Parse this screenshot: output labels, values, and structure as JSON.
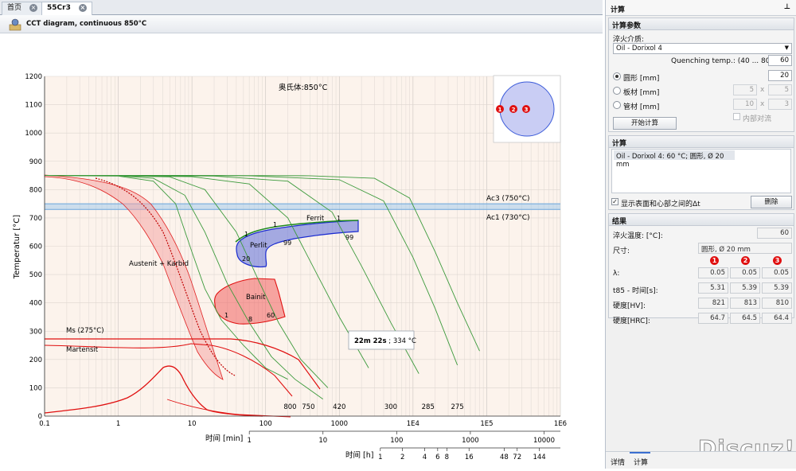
{
  "tabs": [
    {
      "label": "首页",
      "close": "×"
    },
    {
      "label": "55Cr3",
      "close": "×"
    }
  ],
  "doc_title": "CCT diagram, continuous 850°C",
  "colors": {
    "accent_blue": "#3b5bd9",
    "martensite_red": "#e01010",
    "ferrit_green": "#1f8a1f",
    "green_curve": "#3c9a3c",
    "ac_band": "#9cc8ec",
    "plot_bg": "#fcf3ec"
  },
  "chart_data": {
    "type": "line",
    "ylabel": "Temperatur [°C]",
    "ylim": [
      0,
      1200
    ],
    "yticks": [
      0,
      100,
      200,
      300,
      400,
      500,
      600,
      700,
      800,
      900,
      1000,
      1100,
      1200
    ],
    "x_scale": "log",
    "xlim": [
      0.1,
      1000000
    ],
    "xticks": [
      "0.1",
      "1",
      "10",
      "100",
      "1000",
      "1E4",
      "1E5",
      "1E6"
    ],
    "x_min_axis": {
      "label": "时间 [min]",
      "ticks": [
        "1",
        "10",
        "100",
        "1000",
        "10000"
      ]
    },
    "x_h_axis": {
      "label": "时间 [h]",
      "ticks": [
        "1",
        "2",
        "4",
        "6",
        "8",
        "16",
        "48",
        "72",
        "144"
      ]
    },
    "grid": true,
    "annotations": {
      "austenit": "奥氏体:850°C",
      "ac3": "Ac3 (750°C)",
      "ac1": "Ac1 (730°C)",
      "ferrit": "Ferrit",
      "perlit": "Perlit",
      "bainit": "Bainit",
      "austenit_karbid": "Austenit + Karbid",
      "ms": "Ms (275°C)",
      "martensit": "Martensit",
      "tooltip_bold": "22m 22s",
      "tooltip_rest": " ; 334 °C",
      "ferrit_1": "1",
      "ferrit_1b": "1",
      "ferrit_99": "99",
      "perlit_1": "1",
      "perlit_99": "99",
      "perlit_20": "20",
      "bainit_1": "1",
      "bainit_8": "8",
      "bainit_60": "60"
    },
    "hardness_labels": [
      {
        "label": "800",
        "x": 215
      },
      {
        "label": "750",
        "x": 380
      },
      {
        "label": "420",
        "x": 1000
      },
      {
        "label": "300",
        "x": 5000
      },
      {
        "label": "285",
        "x": 16000
      },
      {
        "label": "275",
        "x": 40000
      }
    ],
    "ac3_temp": 750,
    "ac1_temp": 730,
    "ms_temp": 275,
    "series": [
      {
        "x": [
          0.1,
          1,
          3,
          6,
          10,
          15,
          25,
          50,
          100,
          200
        ],
        "y": [
          850,
          848,
          830,
          750,
          580,
          450,
          340,
          250,
          170,
          130
        ]
      },
      {
        "x": [
          0.1,
          1,
          3,
          8,
          15,
          30,
          60,
          120,
          250,
          600
        ],
        "y": [
          850,
          849,
          840,
          780,
          650,
          470,
          330,
          210,
          130,
          60
        ]
      },
      {
        "x": [
          0.1,
          1,
          5,
          15,
          40,
          80,
          150,
          300,
          700
        ],
        "y": [
          850,
          849,
          845,
          800,
          650,
          480,
          330,
          200,
          100
        ]
      },
      {
        "x": [
          0.1,
          1,
          10,
          60,
          200,
          500,
          1000,
          2500
        ],
        "y": [
          850,
          849,
          846,
          820,
          700,
          500,
          350,
          170
        ]
      },
      {
        "x": [
          0.1,
          1,
          20,
          200,
          800,
          2000,
          5000,
          12000
        ],
        "y": [
          850,
          850,
          848,
          830,
          720,
          530,
          330,
          150
        ]
      },
      {
        "x": [
          0.1,
          1,
          60,
          1000,
          4000,
          10000,
          20000,
          40000
        ],
        "y": [
          850,
          850,
          849,
          835,
          760,
          560,
          380,
          180
        ]
      },
      {
        "x": [
          0.1,
          10,
          400,
          3000,
          9000,
          20000,
          40000,
          80000
        ],
        "y": [
          850,
          850,
          849,
          840,
          770,
          580,
          400,
          230
        ]
      }
    ],
    "circle_points": [
      "1",
      "2",
      "3"
    ]
  },
  "right": {
    "header": "计算",
    "pin": "⊥",
    "params": {
      "title": "计算参数",
      "medium_label": "淬火介质:",
      "medium_value": "Oil - Dorixol 4",
      "quench_label": "Quenching temp.: (40 ... 80):",
      "quench_value": "60",
      "round_label": "圆形 [mm]",
      "round_value": "20",
      "plate_label": "板材 [mm]",
      "plate_a": "5",
      "plate_b": "5",
      "tube_label": "管材 [mm]",
      "tube_a": "10",
      "tube_b": "3",
      "x_sign": "x",
      "inner_label": "内部对流",
      "start_button": "开始计算"
    },
    "calc": {
      "title": "计算",
      "entry": "Oil - Dorixol 4: 60 °C; 圆形, Ø 20 mm",
      "show_diff": "显示表面和心部之间的Δt",
      "delete_button": "删除"
    },
    "results": {
      "title": "结果",
      "quench_temp_label": "淬火温度: [°C]:",
      "quench_temp_value": "60",
      "size_label": "尺寸:",
      "size_value": "圆形, Ø 20 mm",
      "cols": [
        "1",
        "2",
        "3"
      ],
      "rows": [
        {
          "label": "λ:",
          "v": [
            "0.05",
            "0.05",
            "0.05"
          ]
        },
        {
          "label": "t85 - 时间[s]:",
          "v": [
            "5.31",
            "5.39",
            "5.39"
          ]
        },
        {
          "label": "硬度[HV]:",
          "v": [
            "821",
            "813",
            "810"
          ]
        },
        {
          "label": "硬度[HRC]:",
          "v": [
            "64.7",
            "64.5",
            "64.4"
          ]
        }
      ]
    },
    "bottom_tabs": [
      "详情",
      "计算"
    ],
    "watermark": "Discuz!"
  }
}
